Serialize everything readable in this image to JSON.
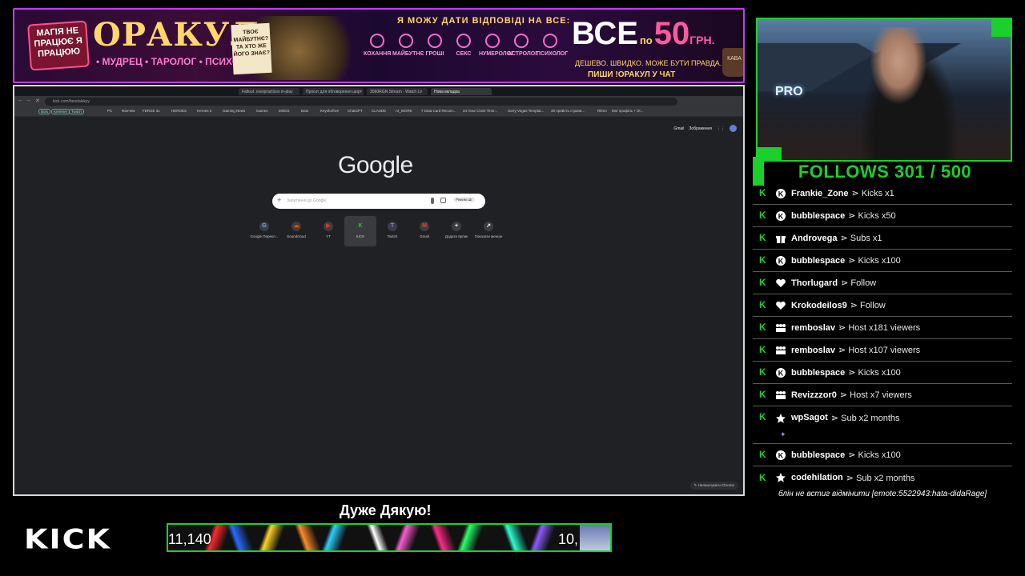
{
  "banner": {
    "magic_sign": "МАГІЯ НЕ ПРАЦЮЄ Я ПРАЦЮЮ",
    "title": "ОРАКУЛ",
    "subtitle": "• МУДРЕЦ • ТАРОЛОГ • ПСИХОЛОГ •",
    "note": "ТВОЄ МАЙБУТНЄ? ТА ХТО ЖЕ ЙОГО ЗНАЄ?",
    "tagline": "Я МОЖУ ДАТИ ВІДПОВІДІ НА ВСЕ:",
    "categories": [
      "КОХАННЯ",
      "МАЙБУТНЄ",
      "ГРОШІ",
      "СЕКС",
      "НУМЕРОЛОГ",
      "АСТРОЛОГ",
      "ПСИХОЛОГ"
    ],
    "price_all": "ВСЕ",
    "price_by": "по",
    "price_num": "50",
    "price_cur": "ГРН.",
    "cheap": "ДЕШЕВО. ШВИДКО. МОЖЕ БУТИ ПРАВДА.",
    "write": "ПИШИ !ОРАКУЛ У ЧАТ",
    "cup": "КАВА"
  },
  "browser": {
    "tabs": [
      "Fallout: overpractices in-play",
      "Проєкт для обговорення шорт",
      "3090RGN Stream - Watch Lir",
      "Нова вкладка"
    ],
    "url": "kick.com/bendalskyy",
    "bookmarks": [
      "Bots",
      "Kreemer",
      "Twitch",
      "PC",
      "Фанчем",
      "FERGE 31",
      "HEROES",
      "Heroes 5",
      "Gaming News",
      "Games",
      "MODS",
      "Boto",
      "Keysforfree",
      "ChatGPT",
      "CLAUDE",
      "AI_WORK",
      "7 Data Card Recom...",
      "24 Hour Clock Time...",
      "Sorry Vegas Templat...",
      "30 прийсть страни...",
      "Ritmo",
      "Мої профіль + Ol..."
    ],
    "google_links": [
      "Gmail",
      "Зображення"
    ],
    "logo": "Google",
    "search_placeholder": "Запитання до Google",
    "ai_mode": "Режим ШІ",
    "shortcuts": [
      {
        "label": "Google Перекл...",
        "icon": "G"
      },
      {
        "label": "Soundcloud",
        "icon": "☁"
      },
      {
        "label": "YT",
        "icon": "▶"
      },
      {
        "label": "KICK",
        "icon": "K"
      },
      {
        "label": "Twitch",
        "icon": "T"
      },
      {
        "label": "Gmail",
        "icon": "M"
      },
      {
        "label": "Додати ярлик",
        "icon": "+"
      },
      {
        "label": "Показати менше",
        "icon": "↗"
      }
    ],
    "customize": "✎ Налаштувати Chrome"
  },
  "cam": {
    "sign": "PRO"
  },
  "follows": "FOLLOWS 301 / 500",
  "events": [
    {
      "user": "Frankie_Zone",
      "action": "Kicks x1",
      "icon": "kick-icon"
    },
    {
      "user": "bubblespace",
      "action": "Kicks x50",
      "icon": "kick-icon"
    },
    {
      "user": "Androvega",
      "action": "Subs x1",
      "icon": "gift-icon"
    },
    {
      "user": "bubblespace",
      "action": "Kicks x100",
      "icon": "kick-icon"
    },
    {
      "user": "Thorlugard",
      "action": "Follow",
      "icon": "heart-icon"
    },
    {
      "user": "Krokodeilos9",
      "action": "Follow",
      "icon": "heart-icon"
    },
    {
      "user": "remboslav",
      "action": "Host x181 viewers",
      "icon": "users-icon"
    },
    {
      "user": "remboslav",
      "action": "Host x107 viewers",
      "icon": "users-icon"
    },
    {
      "user": "bubblespace",
      "action": "Kicks x100",
      "icon": "kick-icon"
    },
    {
      "user": "Revizzzor0",
      "action": "Host x7 viewers",
      "icon": "users-icon"
    },
    {
      "user": "wpSagot",
      "action": "Sub x2 months",
      "icon": "star-icon"
    },
    {
      "user": "bubblespace",
      "action": "Kicks x100",
      "icon": "kick-icon"
    },
    {
      "user": "codehilation",
      "action": "Sub x2 months",
      "icon": "star-icon"
    }
  ],
  "sep": "⋗",
  "last_message": "блін не встиг відмінити [emote:5522943:hata-didaRage]",
  "kick_logo": "KICK",
  "thanks": "Дуже Дякую!",
  "goal": {
    "left": "11,140",
    "right": "10,"
  },
  "colors": {
    "accent": "#1ad02a",
    "banner_border": "#c23cff"
  }
}
